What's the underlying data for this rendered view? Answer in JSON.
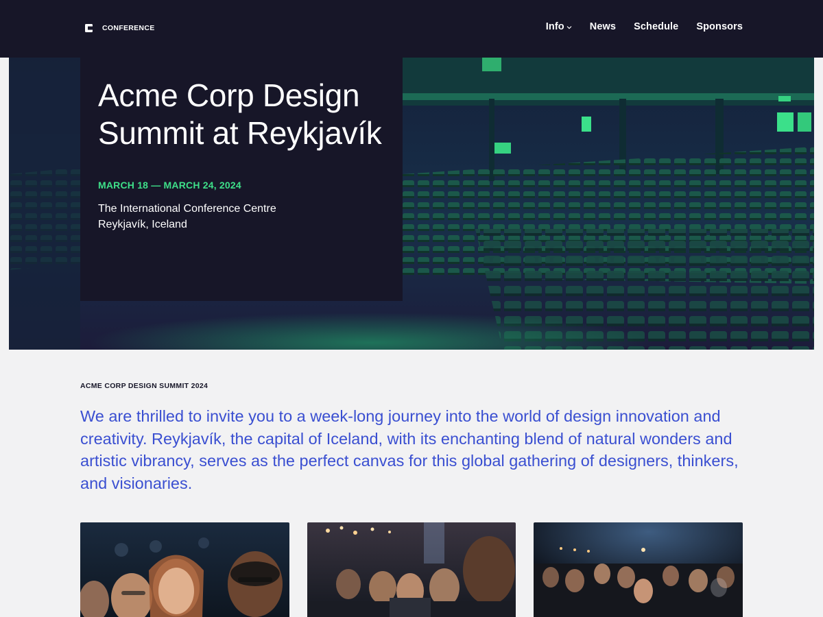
{
  "header": {
    "logo_text": "CONFERENCE",
    "nav": [
      {
        "label": "Info",
        "has_dropdown": true
      },
      {
        "label": "News"
      },
      {
        "label": "Schedule"
      },
      {
        "label": "Sponsors"
      }
    ]
  },
  "hero": {
    "title": "Acme Corp Design Summit at Reykjavík",
    "dates": "MARCH 18 — MARCH 24, 2024",
    "venue_line1": "The International Conference Centre",
    "venue_line2": "Reykjavík, Iceland"
  },
  "intro": {
    "eyebrow": "ACME CORP DESIGN SUMMIT 2024",
    "lead": "We are thrilled to invite you to a week-long journey into the world of design innovation and creativity. Reykjavík, the capital of Iceland, with its enchanting blend of natural wonders and artistic vibrancy, serves as the perfect canvas for this global gathering of designers, thinkers, and visionaries."
  },
  "colors": {
    "header_bg": "#171628",
    "accent_green": "#3ee089",
    "lead_blue": "#3a4fd1",
    "page_bg": "#f2f2f3"
  }
}
